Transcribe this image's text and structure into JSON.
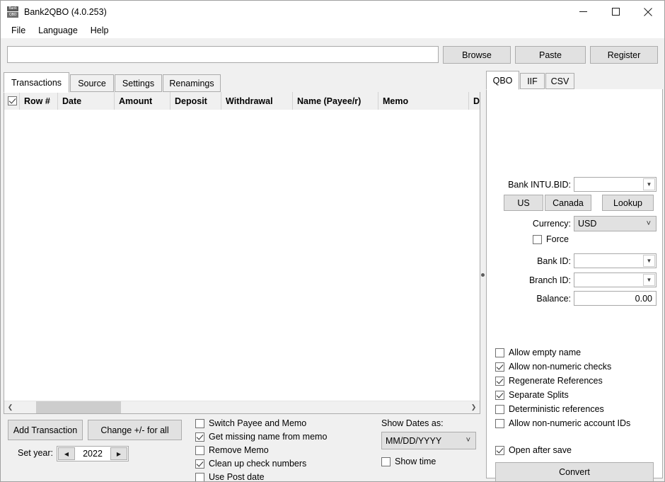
{
  "window": {
    "title": "Bank2QBO (4.0.253)",
    "icon": "app-icon-bank2qbo",
    "icon_text_top": "Bank",
    "icon_text_bottom": "QBO",
    "controls": {
      "minimize": "minimize-icon",
      "maximize": "maximize-icon",
      "close": "close-icon"
    }
  },
  "menubar": {
    "items": [
      {
        "label": "File"
      },
      {
        "label": "Language"
      },
      {
        "label": "Help"
      }
    ]
  },
  "toolbar": {
    "path_value": "",
    "path_placeholder": "",
    "browse_label": "Browse",
    "paste_label": "Paste",
    "register_label": "Register"
  },
  "left_panel": {
    "tabs": [
      {
        "label": "Transactions",
        "active": true
      },
      {
        "label": "Source",
        "active": false
      },
      {
        "label": "Settings",
        "active": false
      },
      {
        "label": "Renamings",
        "active": false
      }
    ],
    "grid": {
      "select_all_checked": true,
      "columns": [
        {
          "label": "Row #"
        },
        {
          "label": "Date"
        },
        {
          "label": "Amount"
        },
        {
          "label": "Deposit"
        },
        {
          "label": "Withdrawal"
        },
        {
          "label": "Name (Payee/r)"
        },
        {
          "label": "Memo"
        },
        {
          "label": "Doc"
        }
      ],
      "rows": []
    },
    "hscroll": {
      "left_arrow": "chevron-left-icon",
      "right_arrow": "chevron-right-icon"
    }
  },
  "right_panel": {
    "tabs": [
      {
        "label": "QBO",
        "active": true
      },
      {
        "label": "IIF",
        "active": false
      },
      {
        "label": "CSV",
        "active": false
      }
    ],
    "fields": {
      "bank_intu_bid_label": "Bank INTU.BID:",
      "bank_intu_bid_value": "",
      "us_label": "US",
      "canada_label": "Canada",
      "lookup_label": "Lookup",
      "currency_label": "Currency:",
      "currency_value": "USD",
      "force_label": "Force",
      "force_checked": false,
      "bank_id_label": "Bank ID:",
      "bank_id_value": "",
      "branch_id_label": "Branch ID:",
      "branch_id_value": "",
      "balance_label": "Balance:",
      "balance_value": "0.00"
    },
    "options": [
      {
        "label": "Allow empty name",
        "checked": false
      },
      {
        "label": "Allow non-numeric checks",
        "checked": true
      },
      {
        "label": "Regenerate References",
        "checked": true
      },
      {
        "label": "Separate Splits",
        "checked": true
      },
      {
        "label": "Deterministic references",
        "checked": false
      },
      {
        "label": "Allow non-numeric account IDs",
        "checked": false
      }
    ],
    "open_after_save": {
      "label": "Open after save",
      "checked": true
    },
    "convert_label": "Convert"
  },
  "bottom": {
    "add_transaction_label": "Add Transaction",
    "change_sign_label": "Change +/- for all",
    "set_year_label": "Set year:",
    "year_value": "2022",
    "year_prev_icon": "arrow-left-icon",
    "year_next_icon": "arrow-right-icon",
    "options": [
      {
        "label": "Switch Payee and Memo",
        "checked": false
      },
      {
        "label": "Get missing name from memo",
        "checked": true
      },
      {
        "label": "Remove Memo",
        "checked": false
      },
      {
        "label": "Clean up check numbers",
        "checked": true
      },
      {
        "label": "Use Post date",
        "checked": false
      }
    ],
    "show_dates_label": "Show Dates as:",
    "date_format_value": "MM/DD/YYYY",
    "show_time_label": "Show time",
    "show_time_checked": false
  },
  "colors": {
    "window_bg": "#f0f0f0",
    "panel_bg": "#ffffff",
    "button_bg": "#e1e1e1",
    "border": "#acacac",
    "scroll_thumb": "#cdcdcd"
  }
}
